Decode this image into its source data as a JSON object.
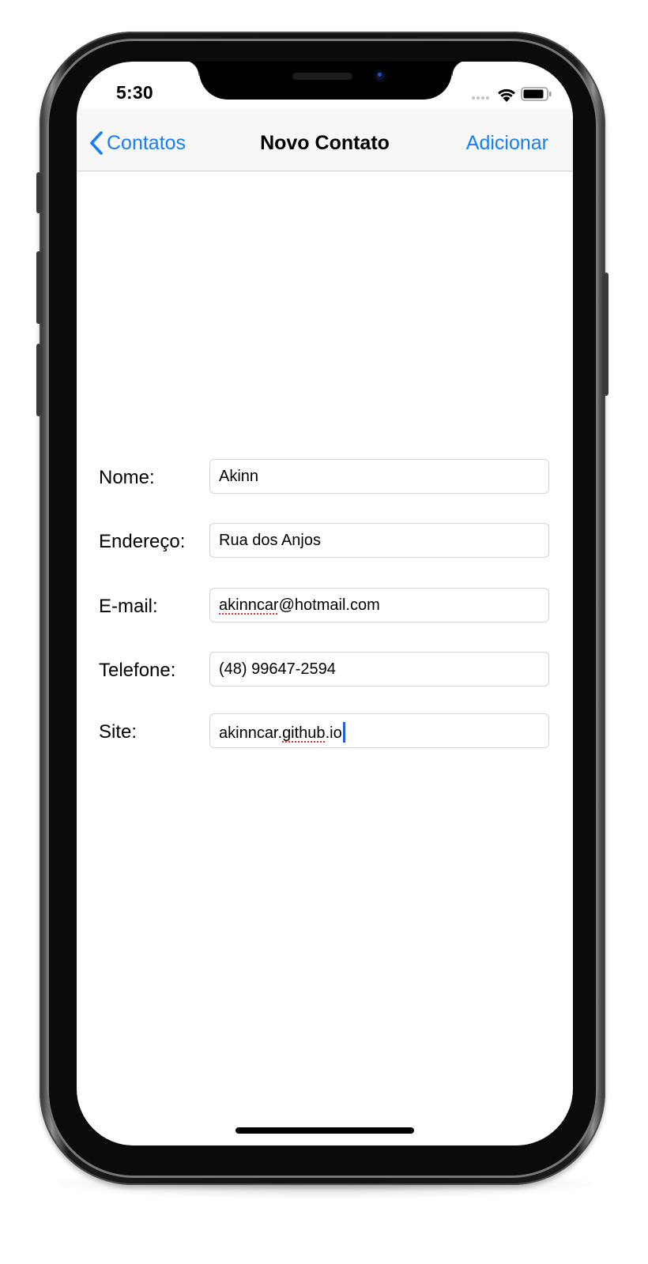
{
  "status_bar": {
    "time": "5:30",
    "icons": [
      "signal-dots-icon",
      "wifi-icon",
      "battery-icon"
    ]
  },
  "navbar": {
    "back_label": "Contatos",
    "title": "Novo Contato",
    "action_label": "Adicionar",
    "tint_color": "#157efb"
  },
  "form": {
    "fields": [
      {
        "label": "Nome:",
        "value": "Akinn"
      },
      {
        "label": "Endereço:",
        "value": "Rua dos Anjos"
      },
      {
        "label": "E-mail:",
        "value_misspelled": "akinncar",
        "value_rest": "@hotmail.com"
      },
      {
        "label": "Telefone:",
        "value": "(48) 99647-2594"
      },
      {
        "label": "Site:",
        "value_pre": "akinncar.",
        "value_misspelled": "github",
        "value_post": ".io"
      }
    ]
  }
}
